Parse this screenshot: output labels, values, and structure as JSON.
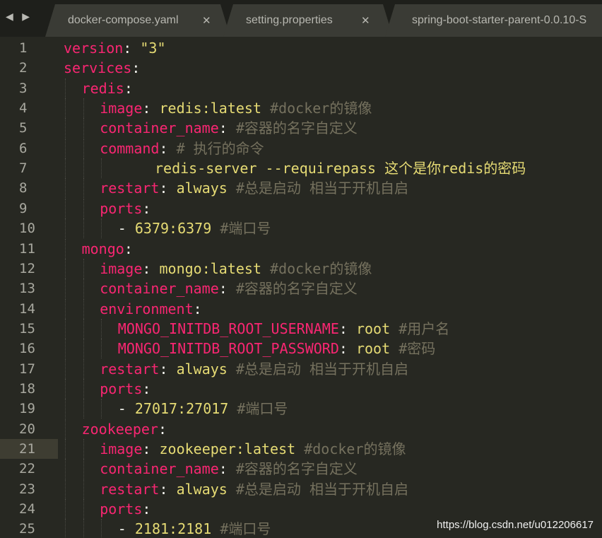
{
  "nav": {
    "arrows": "◀ ▶"
  },
  "tabs": [
    {
      "label": "docker-compose.yaml",
      "close": "✕"
    },
    {
      "label": "setting.properties",
      "close": "✕"
    },
    {
      "label": "spring-boot-starter-parent-0.0.10-S",
      "close": ""
    }
  ],
  "lines": [
    {
      "n": "1",
      "indent": 0,
      "key": "version",
      "sep": ": ",
      "val": "\"3\"",
      "comment": ""
    },
    {
      "n": "2",
      "indent": 0,
      "key": "services",
      "sep": ":",
      "val": "",
      "comment": ""
    },
    {
      "n": "3",
      "indent": 1,
      "key": "redis",
      "sep": ":",
      "val": "",
      "comment": ""
    },
    {
      "n": "4",
      "indent": 2,
      "key": "image",
      "sep": ": ",
      "val": "redis:latest ",
      "comment": "#docker的镜像"
    },
    {
      "n": "5",
      "indent": 2,
      "key": "container_name",
      "sep": ": ",
      "val": "",
      "comment": "#容器的名字自定义"
    },
    {
      "n": "6",
      "indent": 2,
      "key": "command",
      "sep": ": ",
      "val": "",
      "comment": "# 执行的命令"
    },
    {
      "n": "7",
      "indent": 5,
      "key": "",
      "sep": "",
      "val": "redis-server --requirepass 这个是你redis的密码",
      "comment": ""
    },
    {
      "n": "8",
      "indent": 2,
      "key": "restart",
      "sep": ": ",
      "val": "always ",
      "comment": "#总是启动 相当于开机自启"
    },
    {
      "n": "9",
      "indent": 2,
      "key": "ports",
      "sep": ":",
      "val": "",
      "comment": ""
    },
    {
      "n": "10",
      "indent": 3,
      "key": "",
      "sep": "- ",
      "val": "6379:6379 ",
      "comment": "#端口号"
    },
    {
      "n": "11",
      "indent": 1,
      "key": "mongo",
      "sep": ":",
      "val": "",
      "comment": ""
    },
    {
      "n": "12",
      "indent": 2,
      "key": "image",
      "sep": ": ",
      "val": "mongo:latest ",
      "comment": "#docker的镜像"
    },
    {
      "n": "13",
      "indent": 2,
      "key": "container_name",
      "sep": ": ",
      "val": "",
      "comment": "#容器的名字自定义"
    },
    {
      "n": "14",
      "indent": 2,
      "key": "environment",
      "sep": ":",
      "val": "",
      "comment": ""
    },
    {
      "n": "15",
      "indent": 3,
      "key": "MONGO_INITDB_ROOT_USERNAME",
      "sep": ": ",
      "val": "root ",
      "comment": "#用户名"
    },
    {
      "n": "16",
      "indent": 3,
      "key": "MONGO_INITDB_ROOT_PASSWORD",
      "sep": ": ",
      "val": "root ",
      "comment": "#密码"
    },
    {
      "n": "17",
      "indent": 2,
      "key": "restart",
      "sep": ": ",
      "val": "always ",
      "comment": "#总是启动 相当于开机自启"
    },
    {
      "n": "18",
      "indent": 2,
      "key": "ports",
      "sep": ":",
      "val": "",
      "comment": ""
    },
    {
      "n": "19",
      "indent": 3,
      "key": "",
      "sep": "- ",
      "val": "27017:27017 ",
      "comment": "#端口号"
    },
    {
      "n": "20",
      "indent": 1,
      "key": "zookeeper",
      "sep": ":",
      "val": "",
      "comment": ""
    },
    {
      "n": "21",
      "indent": 2,
      "key": "image",
      "sep": ": ",
      "val": "zookeeper:latest ",
      "comment": "#docker的镜像"
    },
    {
      "n": "22",
      "indent": 2,
      "key": "container_name",
      "sep": ": ",
      "val": "",
      "comment": "#容器的名字自定义"
    },
    {
      "n": "23",
      "indent": 2,
      "key": "restart",
      "sep": ": ",
      "val": "always ",
      "comment": "#总是启动 相当于开机自启"
    },
    {
      "n": "24",
      "indent": 2,
      "key": "ports",
      "sep": ":",
      "val": "",
      "comment": ""
    },
    {
      "n": "25",
      "indent": 3,
      "key": "",
      "sep": "- ",
      "val": "2181:2181 ",
      "comment": "#端口号"
    }
  ],
  "active_line": "21",
  "watermark": "https://blog.csdn.net/u012206617",
  "colors": {
    "background": "#272822",
    "key": "#f92672",
    "value": "#e6db74",
    "comment": "#75715e",
    "text": "#f8f8f2"
  }
}
